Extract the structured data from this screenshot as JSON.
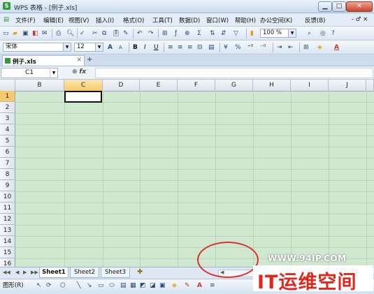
{
  "window": {
    "title": "WPS 表格 - [例子.xls]",
    "minimize_icon": "minimize-icon",
    "maximize_icon": "maximize-icon",
    "close_icon": "close-icon"
  },
  "menubar": {
    "items": [
      "文件(F)",
      "编辑(E)",
      "视图(V)",
      "插入(I)",
      "格式(O)",
      "工具(T)",
      "数据(D)",
      "窗口(W)",
      "帮助(H)",
      "办公空间(K)",
      "反馈(B)"
    ],
    "right_controls": "- ♂ ×"
  },
  "toolbar": {
    "zoom": "100 %",
    "font_name": "宋体",
    "font_size": "12",
    "bold": "B",
    "italic": "I",
    "underline": "U",
    "font_grow": "A",
    "font_shrink": "A",
    "currency": "¥",
    "percent": "%",
    "sum": "Σ",
    "font_color": "A"
  },
  "tabs": {
    "doc_tab": "例子.xls",
    "new_tab": "+"
  },
  "formula": {
    "namebox": "C1",
    "fx": "fx"
  },
  "grid": {
    "columns": [
      "B",
      "C",
      "D",
      "E",
      "F",
      "G",
      "H",
      "I",
      "J"
    ],
    "rows": [
      "1",
      "2",
      "3",
      "4",
      "5",
      "6",
      "7",
      "8",
      "9",
      "10",
      "11",
      "12",
      "13",
      "14",
      "15",
      "16"
    ],
    "selected_column": "C",
    "selected_row": "1"
  },
  "sheets": [
    "Sheet1",
    "Sheet2",
    "Sheet3"
  ],
  "drawbar": {
    "label": "图形(R)"
  },
  "watermark": {
    "url": "WWW.94IP.COM",
    "brand": "IT运维空间"
  },
  "colors": {
    "grid_bg": "#cfe8cf",
    "highlight": "#f7c96a",
    "annotation_circle": "#d9332b",
    "brand": "#e1261c"
  }
}
